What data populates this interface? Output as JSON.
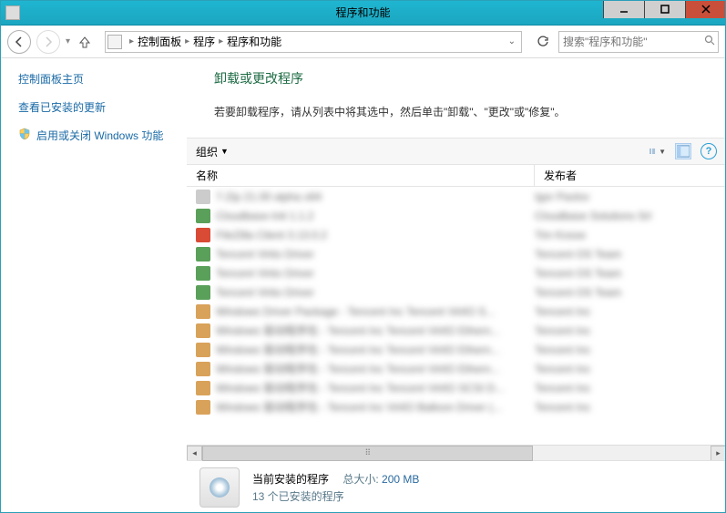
{
  "window": {
    "title": "程序和功能"
  },
  "nav": {
    "breadcrumb": [
      "控制面板",
      "程序",
      "程序和功能"
    ],
    "search_placeholder": "搜索\"程序和功能\""
  },
  "sidebar": {
    "heading": "控制面板主页",
    "links": [
      {
        "label": "查看已安装的更新"
      },
      {
        "label": "启用或关闭 Windows 功能",
        "shield": true
      }
    ]
  },
  "main": {
    "title": "卸载或更改程序",
    "desc": "若要卸载程序，请从列表中将其选中，然后单击\"卸载\"、\"更改\"或\"修复\"。"
  },
  "toolbar": {
    "organize": "组织"
  },
  "columns": {
    "name": "名称",
    "publisher": "发布者"
  },
  "status": {
    "title": "当前安装的程序",
    "size_label": "总大小:",
    "size_value": "200 MB",
    "count": "13 个已安装的程序"
  },
  "rows": [
    {
      "name": "7-Zip 21.00 alpha x64",
      "pub": "Igor Pavlov",
      "cls": ""
    },
    {
      "name": "Cloudbase-Init 1.1.2",
      "pub": "Cloudbase Solutions Srl",
      "cls": "green"
    },
    {
      "name": "FileZilla Client 3.13.0.2",
      "pub": "Tim Kosse",
      "cls": "red"
    },
    {
      "name": "Tencent Virtio Driver",
      "pub": "Tencent OS Team",
      "cls": "green"
    },
    {
      "name": "Tencent Virtio Driver",
      "pub": "Tencent OS Team",
      "cls": "green"
    },
    {
      "name": "Tencent Virtio Driver",
      "pub": "Tencent OS Team",
      "cls": "green"
    },
    {
      "name": "Windows Driver Package - Tencent Inc Tencent VirtIO S...",
      "pub": "Tencent Inc",
      "cls": "orange"
    },
    {
      "name": "Windows 驱动程序包 - Tencent Inc Tencent VirtIO Ethern...",
      "pub": "Tencent Inc",
      "cls": "orange"
    },
    {
      "name": "Windows 驱动程序包 - Tencent Inc Tencent VirtIO Ethern...",
      "pub": "Tencent Inc",
      "cls": "orange"
    },
    {
      "name": "Windows 驱动程序包 - Tencent Inc Tencent VirtIO Ethern...",
      "pub": "Tencent Inc",
      "cls": "orange"
    },
    {
      "name": "Windows 驱动程序包 - Tencent Inc Tencent VirtIO SCSI D...",
      "pub": "Tencent Inc",
      "cls": "orange"
    },
    {
      "name": "Windows 驱动程序包 - Tencent Inc VirtIO Balloon Driver (...",
      "pub": "Tencent Inc",
      "cls": "orange"
    }
  ]
}
